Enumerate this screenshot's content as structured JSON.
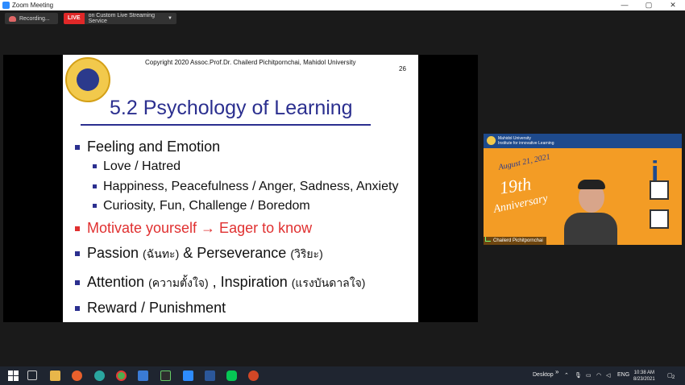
{
  "window": {
    "title": "Zoom Meeting",
    "controls": [
      "—",
      "▢",
      "✕"
    ]
  },
  "toolbar": {
    "recording_label": "Recording...",
    "live_badge": "LIVE",
    "live_label": "on Custom Live Streaming Service"
  },
  "slide": {
    "copyright": "Copyright 2020   Assoc.Prof.Dr. Chailerd Pichitpornchai,        Mahidol University",
    "page_number": "26",
    "title": "5.2 Psychology of Learning",
    "bullets": [
      {
        "text": "Feeling and Emotion"
      },
      {
        "text": "Love / Hatred"
      },
      {
        "text": "Happiness, Peacefulness / Anger, Sadness, Anxiety"
      },
      {
        "text": "Curiosity, Fun, Challenge / Boredom"
      },
      {
        "text": "Motivate yourself → Eager to know"
      },
      {
        "text": "Passion ",
        "thai1": "(ฉันทะ)",
        "mid": " & Perseverance ",
        "thai2": "(วิริยะ)"
      },
      {
        "text": "Attention ",
        "thai1": "(ความตั้งใจ)",
        "mid": " , Inspiration ",
        "thai2": "(แรงบันดาลใจ)"
      },
      {
        "text": "Reward / Punishment"
      }
    ]
  },
  "video": {
    "header_line1": "Mahidol University",
    "header_line2": "Institute for innovative Learning",
    "date": "August 21, 2021",
    "anniv_num": "19th",
    "anniv_word": "Anniversary",
    "big_glyph": "i",
    "participant_name": "Chailerd Pichitpornchai"
  },
  "taskbar": {
    "desktop_label": "Desktop",
    "language": "ENG",
    "time": "10:38 AM",
    "date": "8/23/2021",
    "notifications": "2"
  },
  "colors": {
    "live_red": "#e02828",
    "slide_title_blue": "#2b2f8f",
    "motivate_red": "#e03030",
    "video_orange": "#f39c25"
  }
}
